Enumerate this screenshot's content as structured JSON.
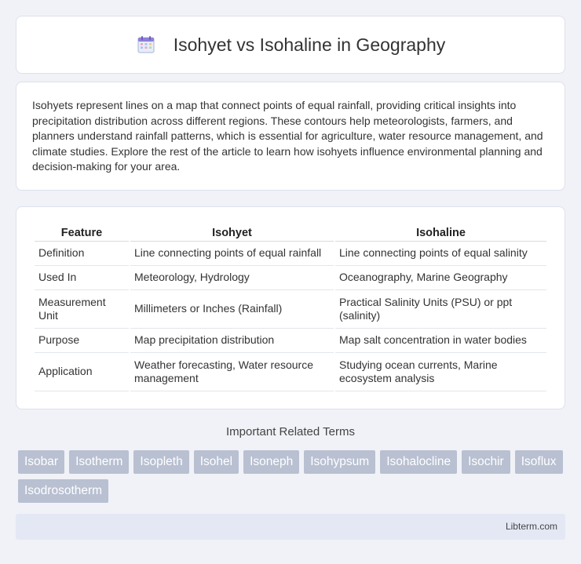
{
  "header": {
    "title": "Isohyet vs Isohaline in Geography",
    "icon": "calendar-icon"
  },
  "intro": {
    "text": "Isohyets represent lines on a map that connect points of equal rainfall, providing critical insights into precipitation distribution across different regions. These contours help meteorologists, farmers, and planners understand rainfall patterns, which is essential for agriculture, water resource management, and climate studies. Explore the rest of the article to learn how isohyets influence environmental planning and decision-making for your area."
  },
  "table": {
    "headers": [
      "Feature",
      "Isohyet",
      "Isohaline"
    ],
    "rows": [
      [
        "Definition",
        "Line connecting points of equal rainfall",
        "Line connecting points of equal salinity"
      ],
      [
        "Used In",
        "Meteorology, Hydrology",
        "Oceanography, Marine Geography"
      ],
      [
        "Measurement Unit",
        "Millimeters or Inches (Rainfall)",
        "Practical Salinity Units (PSU) or ppt (salinity)"
      ],
      [
        "Purpose",
        "Map precipitation distribution",
        "Map salt concentration in water bodies"
      ],
      [
        "Application",
        "Weather forecasting, Water resource management",
        "Studying ocean currents, Marine ecosystem analysis"
      ]
    ]
  },
  "related": {
    "title": "Important Related Terms",
    "tags": [
      "Isobar",
      "Isotherm",
      "Isopleth",
      "Isohel",
      "Isoneph",
      "Isohypsum",
      "Isohalocline",
      "Isochir",
      "Isoflux",
      "Isodrosotherm"
    ]
  },
  "footer": {
    "brand": "Libterm.com"
  },
  "colors": {
    "tag_bg": "#b8c0d1",
    "footer_bg": "#e3e8f4",
    "page_bg": "#f0f2f7"
  }
}
